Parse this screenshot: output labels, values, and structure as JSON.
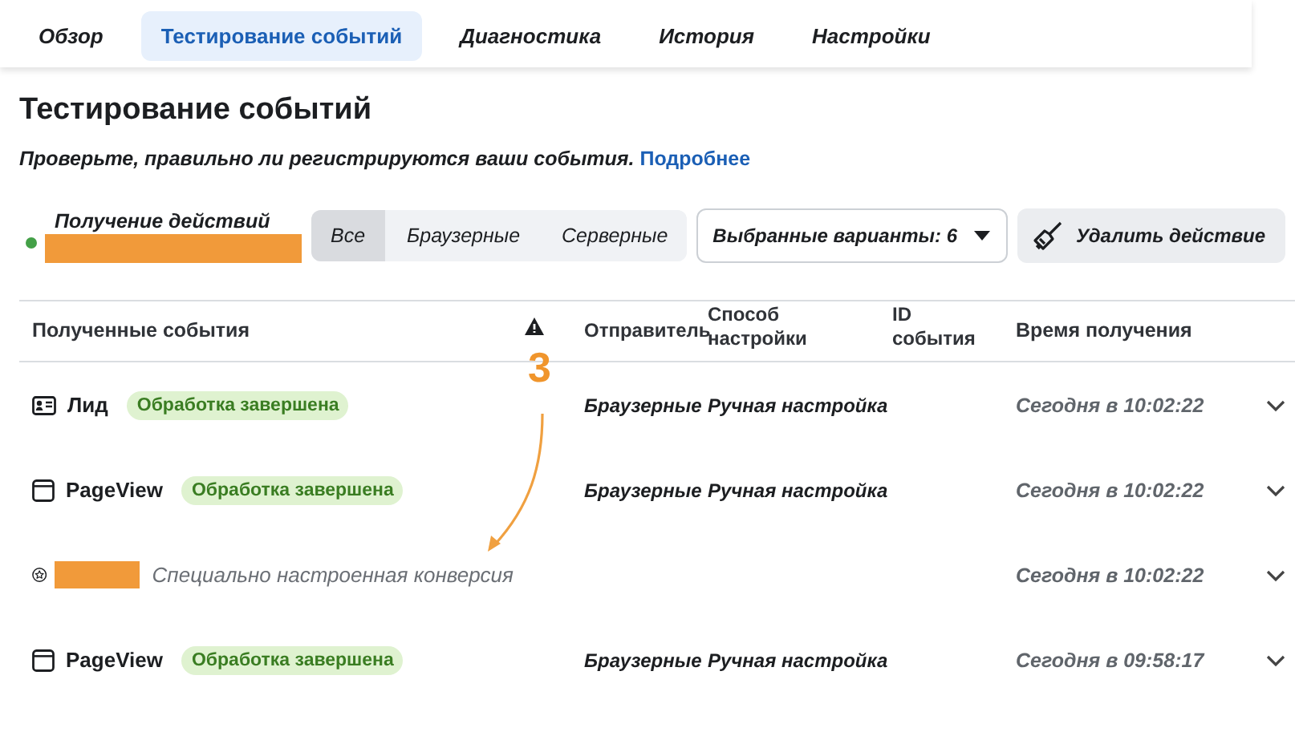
{
  "tabs": [
    {
      "label": "Обзор",
      "selected": false
    },
    {
      "label": "Тестирование событий",
      "selected": true
    },
    {
      "label": "Диагностика",
      "selected": false
    },
    {
      "label": "История",
      "selected": false
    },
    {
      "label": "Настройки",
      "selected": false
    }
  ],
  "page": {
    "title": "Тестирование событий",
    "description": "Проверьте, правильно ли регистрируются ваши события.",
    "link": "Подробнее"
  },
  "status": {
    "label": "Получение действий",
    "color": "#43a047"
  },
  "filters": [
    {
      "label": "Все",
      "selected": true
    },
    {
      "label": "Браузерные",
      "selected": false
    },
    {
      "label": "Серверные",
      "selected": false
    }
  ],
  "variants_dropdown": {
    "label": "Выбранные варианты: 6"
  },
  "delete_button": {
    "label": "Удалить действие"
  },
  "table": {
    "columns": [
      "Полученные события",
      "Отправитель",
      "Способ настройки",
      "ID события",
      "Время получения"
    ],
    "rows": [
      {
        "kind": "lead",
        "name": "Лид",
        "status": "Обработка завершена",
        "sender": "Браузерные",
        "method": "Ручная настройка",
        "time": "Сегодня в 10:02:22",
        "expanded": false
      },
      {
        "kind": "pageview",
        "name": "PageView",
        "status": "Обработка завершена",
        "sender": "Браузерные",
        "method": "Ручная настройка",
        "time": "Сегодня в 10:02:22",
        "expanded": false
      },
      {
        "kind": "conversion",
        "description": "Специально настроенная конверсия",
        "time": "Сегодня в 10:02:22",
        "expanded": false
      },
      {
        "kind": "pageview",
        "name": "PageView",
        "status": "Обработка завершена",
        "sender": "Браузерные",
        "method": "Ручная настройка",
        "time": "Сегодня в 09:58:17",
        "expanded": false
      }
    ]
  },
  "annotation": {
    "label": "3"
  }
}
